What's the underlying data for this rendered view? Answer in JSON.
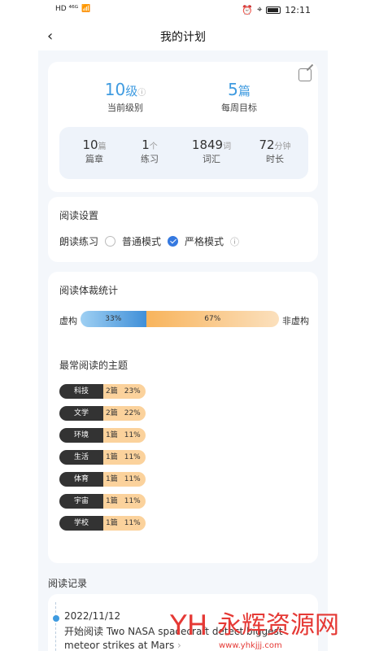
{
  "status": {
    "left": "HD ⁴⁶ᴳ",
    "time": "12:11"
  },
  "header": {
    "title": "我的计划"
  },
  "plan": {
    "level_value": "10",
    "level_unit": "级",
    "level_label": "当前级别",
    "weekly_value": "5",
    "weekly_unit": "篇",
    "weekly_label": "每周目标",
    "stats": [
      {
        "n": "10",
        "u": "篇",
        "l": "篇章"
      },
      {
        "n": "1",
        "u": "个",
        "l": "练习"
      },
      {
        "n": "1849",
        "u": "词",
        "l": "词汇"
      },
      {
        "n": "72",
        "u": "分钟",
        "l": "时长"
      }
    ]
  },
  "settings": {
    "title": "阅读设置",
    "practice": "朗读练习",
    "normal": "普通模式",
    "strict": "严格模式"
  },
  "genre": {
    "title": "阅读体裁统计",
    "left": "虚构",
    "right": "非虚构",
    "fiction_pct": "33%",
    "nonfiction_pct": "67%",
    "fiction_share": 0.33
  },
  "topics": {
    "title": "最常阅读的主题",
    "items": [
      {
        "name": "科技",
        "count": "2篇",
        "pct": "23%"
      },
      {
        "name": "文学",
        "count": "2篇",
        "pct": "22%"
      },
      {
        "name": "环境",
        "count": "1篇",
        "pct": "11%"
      },
      {
        "name": "生活",
        "count": "1篇",
        "pct": "11%"
      },
      {
        "name": "体育",
        "count": "1篇",
        "pct": "11%"
      },
      {
        "name": "宇宙",
        "count": "1篇",
        "pct": "11%"
      },
      {
        "name": "学校",
        "count": "1篇",
        "pct": "11%"
      }
    ]
  },
  "records": {
    "title": "阅读记录",
    "date": "2022/11/12",
    "prefix": "开始阅读",
    "text": "Two NASA spacecraft detect biggest meteor strikes at Mars"
  },
  "watermark": {
    "text": "永辉资源网",
    "url": "www.yhkjjj.com"
  },
  "colors": {
    "accent": "#3f9be0",
    "check": "#3579e0",
    "orange": "#f8b45c"
  }
}
